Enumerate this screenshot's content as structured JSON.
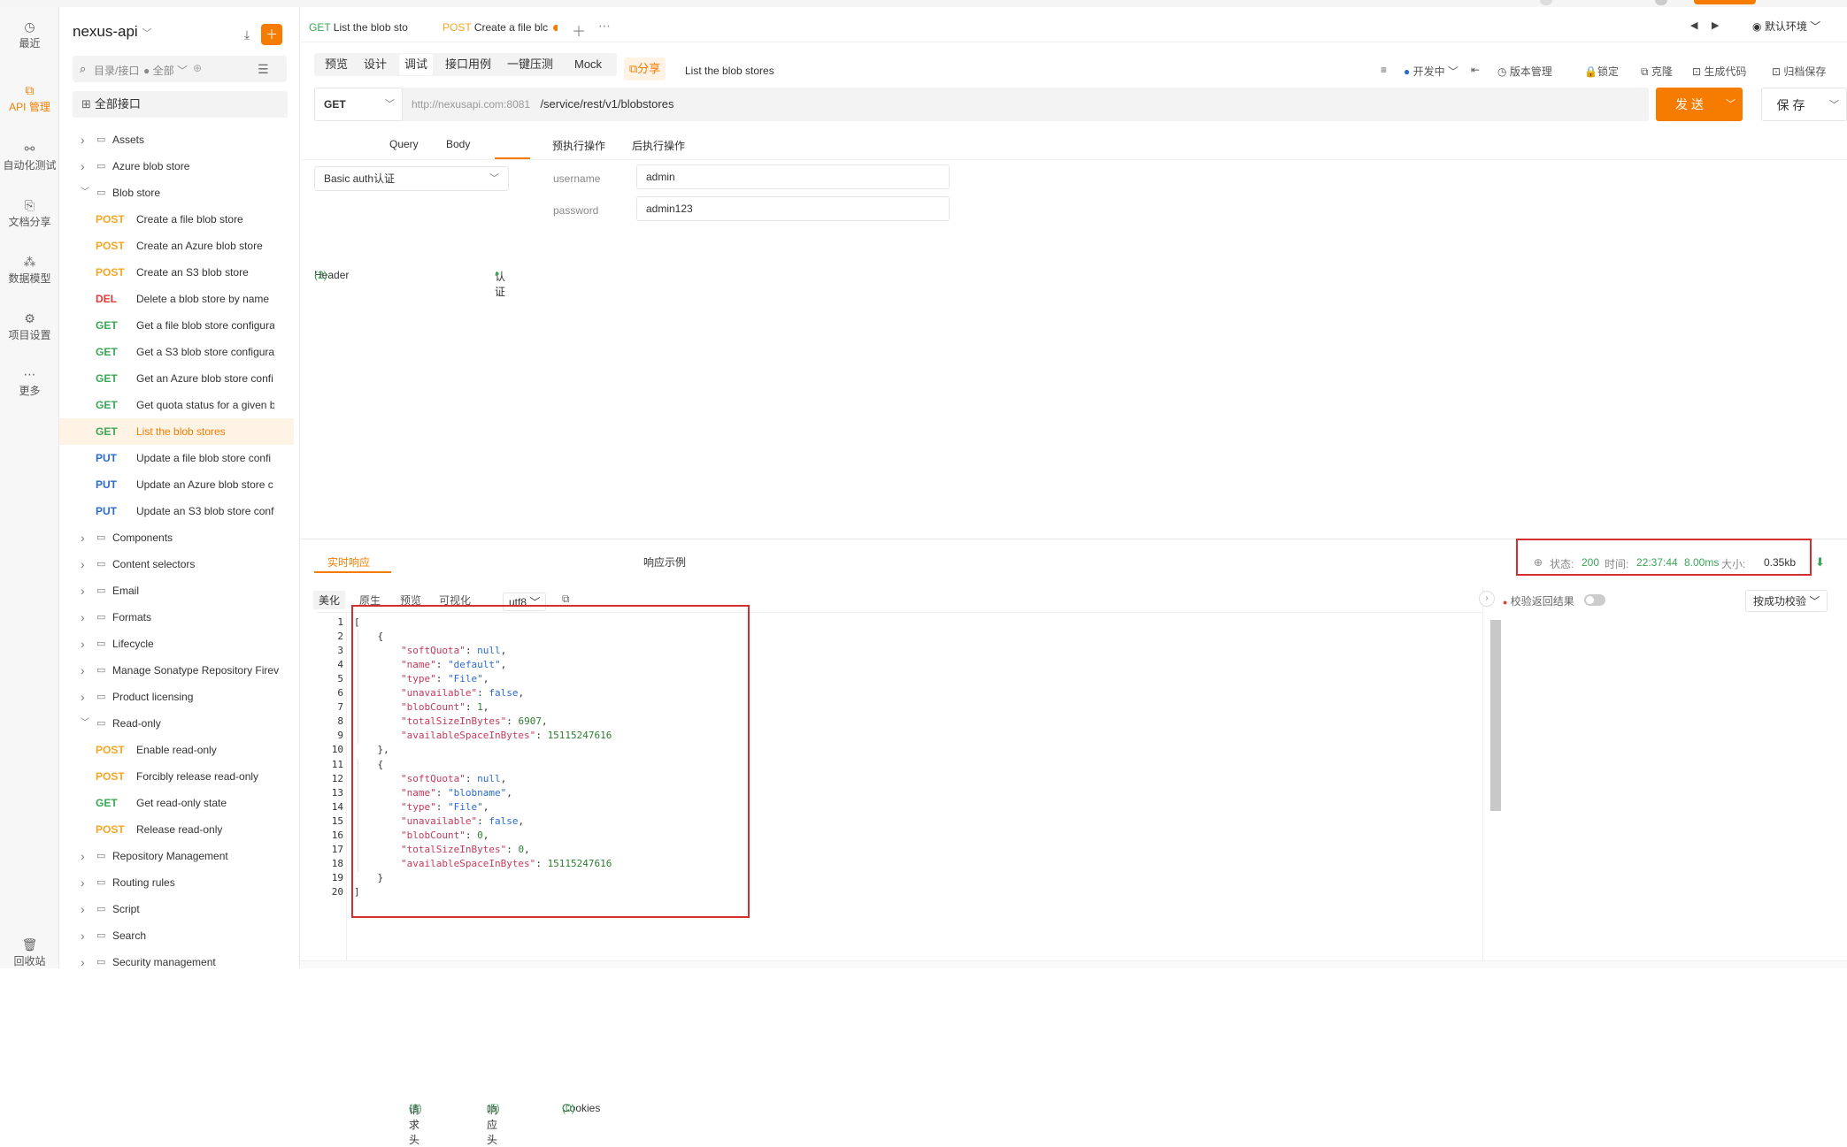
{
  "rail": [
    {
      "label": "最近",
      "icon": "clock-icon",
      "glyph": "◷"
    },
    {
      "label": "API 管理",
      "icon": "api-management-icon",
      "glyph": "⧉"
    },
    {
      "label": "自动化测试",
      "icon": "automation-test-icon",
      "glyph": "⚯"
    },
    {
      "label": "文档分享",
      "icon": "doc-share-icon",
      "glyph": "⎘"
    },
    {
      "label": "数据模型",
      "icon": "data-model-icon",
      "glyph": "⁂"
    },
    {
      "label": "项目设置",
      "icon": "project-settings-icon",
      "glyph": "⚙"
    },
    {
      "label": "更多",
      "icon": "more-icon",
      "glyph": "⋯"
    },
    {
      "label": "回收站",
      "icon": "trash-icon",
      "glyph": "🗑"
    }
  ],
  "sidebar": {
    "project": "nexus-api",
    "search_placeholder": "目录/接口",
    "filter": "全部",
    "all_api": "全部接口",
    "tree": [
      {
        "type": "folder",
        "name": "Assets",
        "open": false
      },
      {
        "type": "folder",
        "name": "Azure blob store",
        "open": false
      },
      {
        "type": "folder",
        "name": "Blob store",
        "open": true
      },
      {
        "type": "api",
        "method": "POST",
        "name": "Create a file blob store"
      },
      {
        "type": "api",
        "method": "POST",
        "name": "Create an Azure blob store"
      },
      {
        "type": "api",
        "method": "POST",
        "name": "Create an S3 blob store"
      },
      {
        "type": "api",
        "method": "DEL",
        "name": "Delete a blob store by name"
      },
      {
        "type": "api",
        "method": "GET",
        "name": "Get a file blob store configura"
      },
      {
        "type": "api",
        "method": "GET",
        "name": "Get a S3 blob store configura"
      },
      {
        "type": "api",
        "method": "GET",
        "name": "Get an Azure blob store confi"
      },
      {
        "type": "api",
        "method": "GET",
        "name": "Get quota status for a given b"
      },
      {
        "type": "api",
        "method": "GET",
        "name": "List the blob stores",
        "active": true
      },
      {
        "type": "api",
        "method": "PUT",
        "name": "Update a file blob store confi"
      },
      {
        "type": "api",
        "method": "PUT",
        "name": "Update an Azure blob store c"
      },
      {
        "type": "api",
        "method": "PUT",
        "name": "Update an S3 blob store conf"
      },
      {
        "type": "folder",
        "name": "Components",
        "open": false
      },
      {
        "type": "folder",
        "name": "Content selectors",
        "open": false
      },
      {
        "type": "folder",
        "name": "Email",
        "open": false
      },
      {
        "type": "folder",
        "name": "Formats",
        "open": false
      },
      {
        "type": "folder",
        "name": "Lifecycle",
        "open": false
      },
      {
        "type": "folder",
        "name": "Manage Sonatype Repository Firev",
        "open": false
      },
      {
        "type": "folder",
        "name": "Product licensing",
        "open": false
      },
      {
        "type": "folder",
        "name": "Read-only",
        "open": true
      },
      {
        "type": "api",
        "method": "POST",
        "name": "Enable read-only"
      },
      {
        "type": "api",
        "method": "POST",
        "name": "Forcibly release read-only"
      },
      {
        "type": "api",
        "method": "GET",
        "name": "Get read-only state"
      },
      {
        "type": "api",
        "method": "POST",
        "name": "Release read-only"
      },
      {
        "type": "folder",
        "name": "Repository Management",
        "open": false
      },
      {
        "type": "folder",
        "name": "Routing rules",
        "open": false
      },
      {
        "type": "folder",
        "name": "Script",
        "open": false
      },
      {
        "type": "folder",
        "name": "Search",
        "open": false
      },
      {
        "type": "folder",
        "name": "Security management",
        "open": false
      }
    ]
  },
  "tabs": [
    {
      "method": "GET",
      "title": "List the blob stor"
    },
    {
      "method": "POST",
      "title": "Create a file blc"
    }
  ],
  "env": "默认环境",
  "subtabs": [
    "预览",
    "设计",
    "调试",
    "接口用例",
    "一键压测",
    "Mock"
  ],
  "share": "分享",
  "api_title": "List the blob stores",
  "toolbar": {
    "status": "开发中",
    "version": "版本管理",
    "lock": "锁定",
    "clone": "克隆",
    "codegen": "生成代码",
    "archive": "归档保存"
  },
  "request": {
    "method": "GET",
    "base": "http://nexusapi.com:8081",
    "path": "/service/rest/v1/blobstores",
    "send": "发 送",
    "save": "保 存"
  },
  "req_tabs": {
    "header": "Header",
    "header_count": "(2)",
    "query": "Query",
    "body": "Body",
    "auth": "认证",
    "pre": "预执行操作",
    "post": "后执行操作"
  },
  "auth": {
    "type": "Basic auth认证",
    "username_label": "username",
    "username": "admin",
    "password_label": "password",
    "password": "admin123"
  },
  "resp_tabs": {
    "live": "实时响应",
    "req_headers": "请求头",
    "req_headers_count": "(6)",
    "resp_headers": "响应头",
    "resp_headers_count": "(5)",
    "cookies": "Cookies",
    "cookies_count": "(0)",
    "example": "响应示例"
  },
  "status": {
    "label_status": "状态:",
    "code": "200",
    "label_time": "时间:",
    "time": "22:37:44",
    "duration": "8.00ms",
    "label_size": "大小:",
    "size": "0.35kb"
  },
  "view_modes": [
    "美化",
    "原生",
    "预览",
    "可视化"
  ],
  "encoding": "utf8",
  "validate": {
    "label": "校验返回结果",
    "dropdown": "按成功校验"
  },
  "code_lines": [
    [
      [
        "p",
        "["
      ]
    ],
    [
      [
        "p",
        "    {"
      ]
    ],
    [
      [
        "p",
        "        "
      ],
      [
        "k",
        "\"softQuota\""
      ],
      [
        "p",
        ": "
      ],
      [
        "b",
        "null"
      ],
      [
        "p",
        ","
      ]
    ],
    [
      [
        "p",
        "        "
      ],
      [
        "k",
        "\"name\""
      ],
      [
        "p",
        ": "
      ],
      [
        "s",
        "\"default\""
      ],
      [
        "p",
        ","
      ]
    ],
    [
      [
        "p",
        "        "
      ],
      [
        "k",
        "\"type\""
      ],
      [
        "p",
        ": "
      ],
      [
        "s",
        "\"File\""
      ],
      [
        "p",
        ","
      ]
    ],
    [
      [
        "p",
        "        "
      ],
      [
        "k",
        "\"unavailable\""
      ],
      [
        "p",
        ": "
      ],
      [
        "b",
        "false"
      ],
      [
        "p",
        ","
      ]
    ],
    [
      [
        "p",
        "        "
      ],
      [
        "k",
        "\"blobCount\""
      ],
      [
        "p",
        ": "
      ],
      [
        "n",
        "1"
      ],
      [
        "p",
        ","
      ]
    ],
    [
      [
        "p",
        "        "
      ],
      [
        "k",
        "\"totalSizeInBytes\""
      ],
      [
        "p",
        ": "
      ],
      [
        "n",
        "6907"
      ],
      [
        "p",
        ","
      ]
    ],
    [
      [
        "p",
        "        "
      ],
      [
        "k",
        "\"availableSpaceInBytes\""
      ],
      [
        "p",
        ": "
      ],
      [
        "n",
        "15115247616"
      ]
    ],
    [
      [
        "p",
        "    },"
      ]
    ],
    [
      [
        "p",
        "    {"
      ]
    ],
    [
      [
        "p",
        "        "
      ],
      [
        "k",
        "\"softQuota\""
      ],
      [
        "p",
        ": "
      ],
      [
        "b",
        "null"
      ],
      [
        "p",
        ","
      ]
    ],
    [
      [
        "p",
        "        "
      ],
      [
        "k",
        "\"name\""
      ],
      [
        "p",
        ": "
      ],
      [
        "s",
        "\"blobname\""
      ],
      [
        "p",
        ","
      ]
    ],
    [
      [
        "p",
        "        "
      ],
      [
        "k",
        "\"type\""
      ],
      [
        "p",
        ": "
      ],
      [
        "s",
        "\"File\""
      ],
      [
        "p",
        ","
      ]
    ],
    [
      [
        "p",
        "        "
      ],
      [
        "k",
        "\"unavailable\""
      ],
      [
        "p",
        ": "
      ],
      [
        "b",
        "false"
      ],
      [
        "p",
        ","
      ]
    ],
    [
      [
        "p",
        "        "
      ],
      [
        "k",
        "\"blobCount\""
      ],
      [
        "p",
        ": "
      ],
      [
        "n",
        "0"
      ],
      [
        "p",
        ","
      ]
    ],
    [
      [
        "p",
        "        "
      ],
      [
        "k",
        "\"totalSizeInBytes\""
      ],
      [
        "p",
        ": "
      ],
      [
        "n",
        "0"
      ],
      [
        "p",
        ","
      ]
    ],
    [
      [
        "p",
        "        "
      ],
      [
        "k",
        "\"availableSpaceInBytes\""
      ],
      [
        "p",
        ": "
      ],
      [
        "n",
        "15115247616"
      ]
    ],
    [
      [
        "p",
        "    }"
      ]
    ],
    [
      [
        "p",
        "]"
      ]
    ]
  ]
}
